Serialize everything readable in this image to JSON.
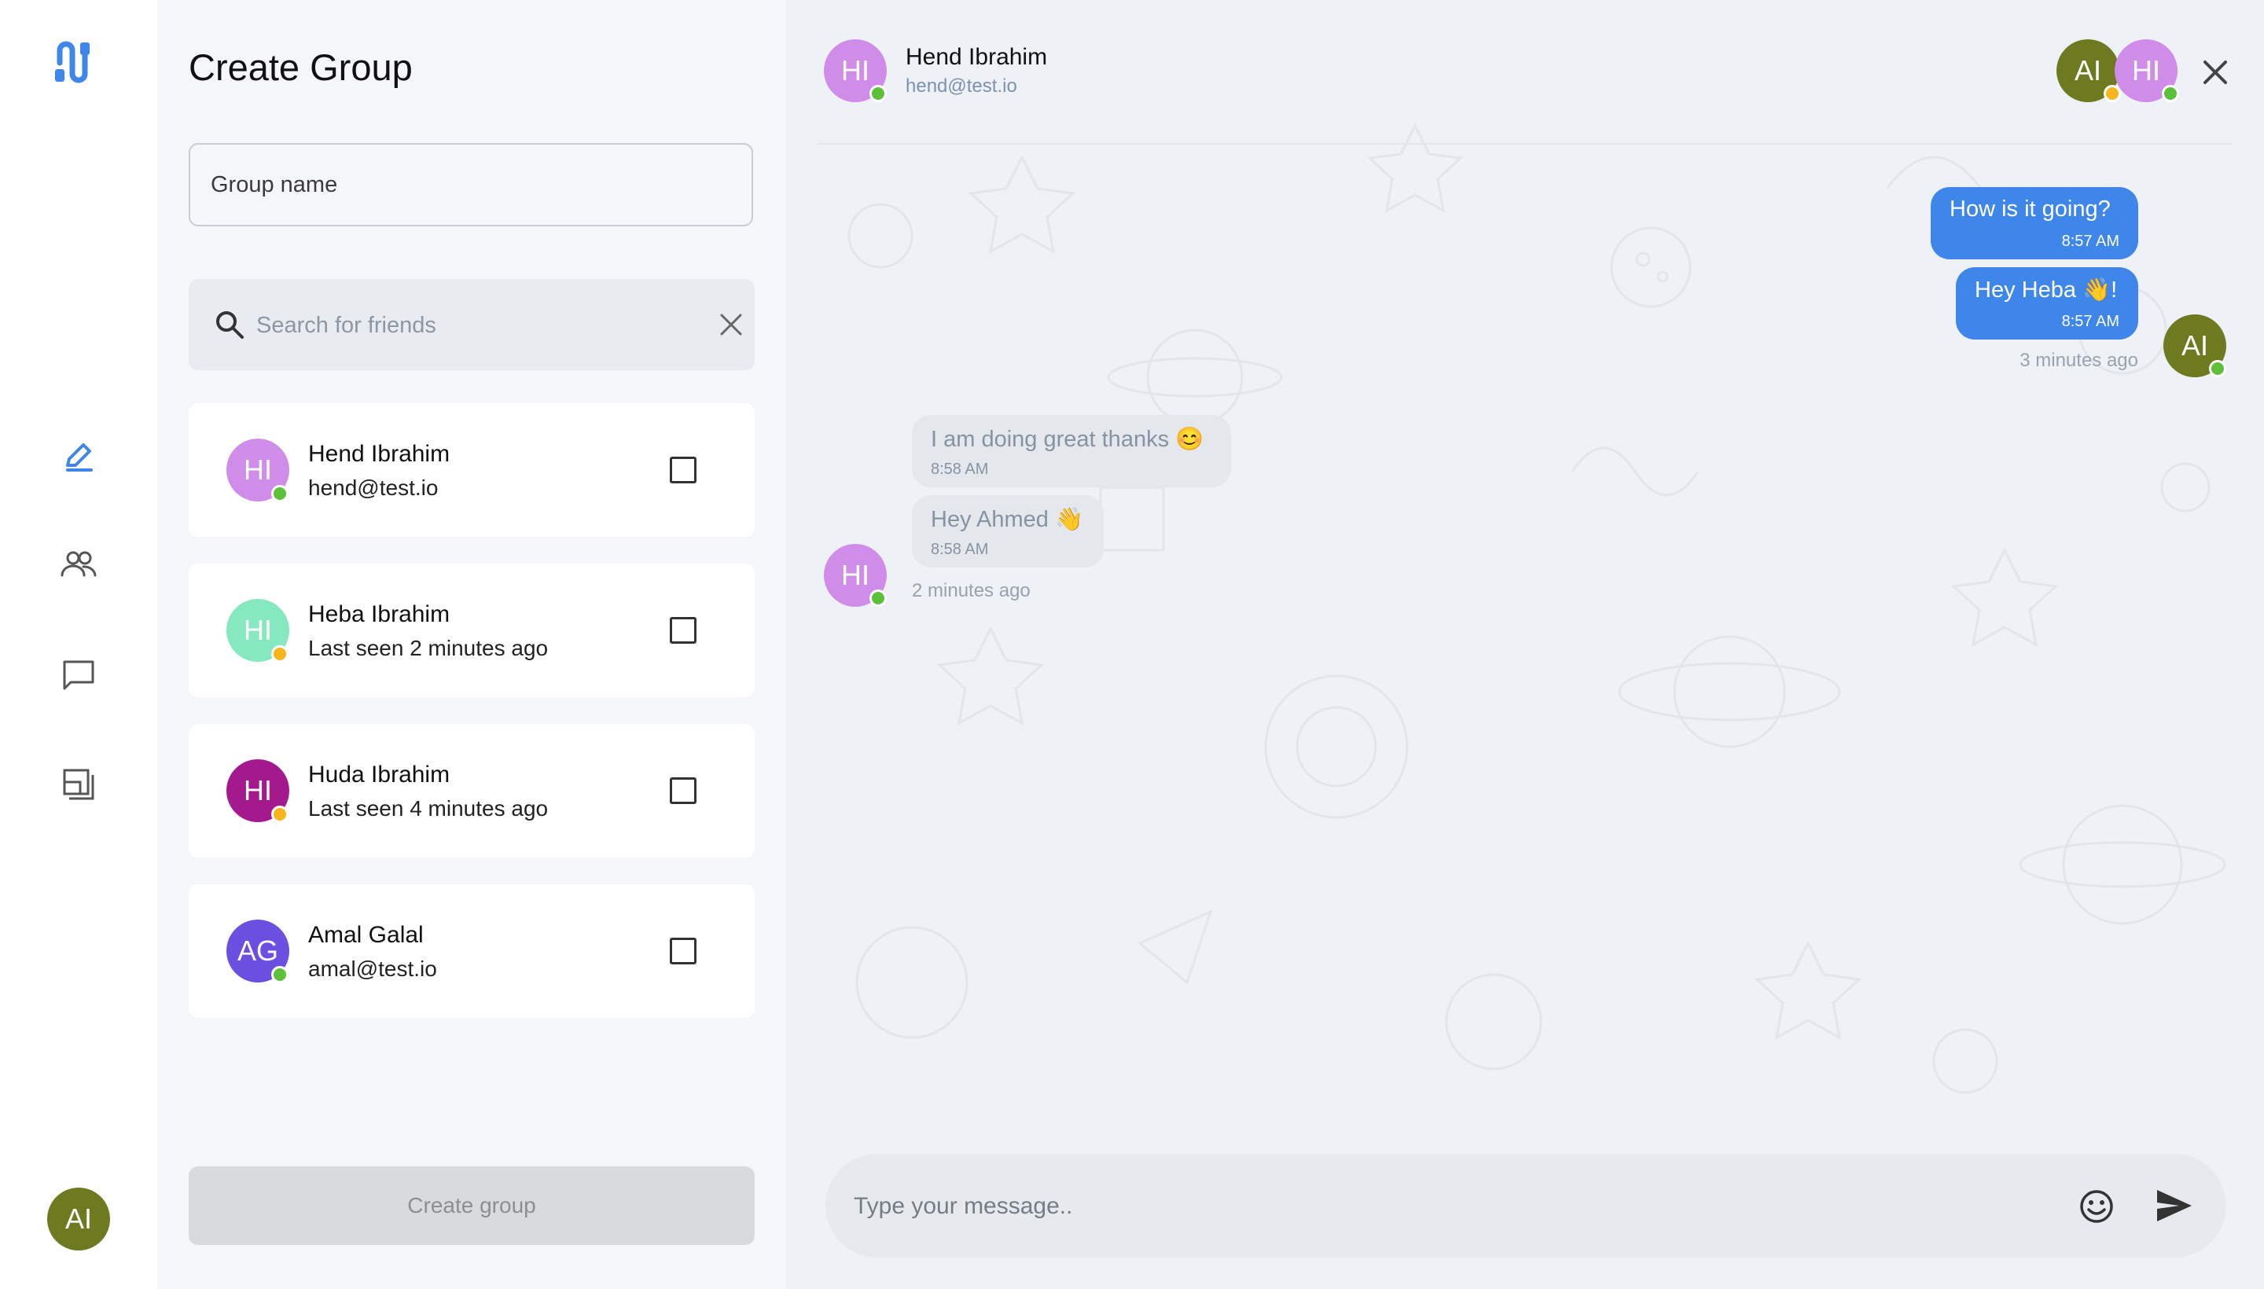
{
  "colors": {
    "accent": "#3f86ea",
    "online": "#5cc03a",
    "away": "#f5b51b",
    "avatar_ai": "#6d7a1f",
    "avatar_hend": "#cf8ce9",
    "avatar_heba": "#86e8bf",
    "avatar_huda": "#a4198e",
    "avatar_amal": "#6a4fe0"
  },
  "rail": {
    "logo_icon": "app-logo",
    "nav_icons": [
      "pen-icon",
      "users-icon",
      "chat-icon",
      "layout-icon"
    ],
    "me_initials": "AI"
  },
  "create_group": {
    "title": "Create Group",
    "group_name_placeholder": "Group name",
    "search_placeholder": "Search for friends",
    "friends": [
      {
        "initials": "HI",
        "name": "Hend Ibrahim",
        "sub": "hend@test.io",
        "status": "online",
        "checked": false
      },
      {
        "initials": "HI",
        "name": "Heba Ibrahim",
        "sub": "Last seen 2 minutes ago",
        "status": "away",
        "checked": false
      },
      {
        "initials": "HI",
        "name": "Huda Ibrahim",
        "sub": "Last seen 4 minutes ago",
        "status": "away",
        "checked": false
      },
      {
        "initials": "AG",
        "name": "Amal Galal",
        "sub": "amal@test.io",
        "status": "online",
        "checked": false
      }
    ],
    "create_label": "Create group"
  },
  "chat": {
    "header": {
      "initials": "HI",
      "name": "Hend Ibrahim",
      "email": "hend@test.io",
      "participants": [
        "AI",
        "HI"
      ]
    },
    "outgoing": {
      "avatar": "AI",
      "messages": [
        {
          "text": "How is it going?",
          "time": "8:57 AM"
        },
        {
          "text": "Hey Heba 👋!",
          "time": "8:57 AM"
        }
      ],
      "ago": "3 minutes ago"
    },
    "incoming": {
      "avatar": "HI",
      "messages": [
        {
          "text": "I am doing great thanks 😊",
          "time": "8:58 AM"
        },
        {
          "text": "Hey Ahmed 👋",
          "time": "8:58 AM"
        }
      ],
      "ago": "2 minutes ago"
    },
    "composer_placeholder": "Type your message.."
  }
}
